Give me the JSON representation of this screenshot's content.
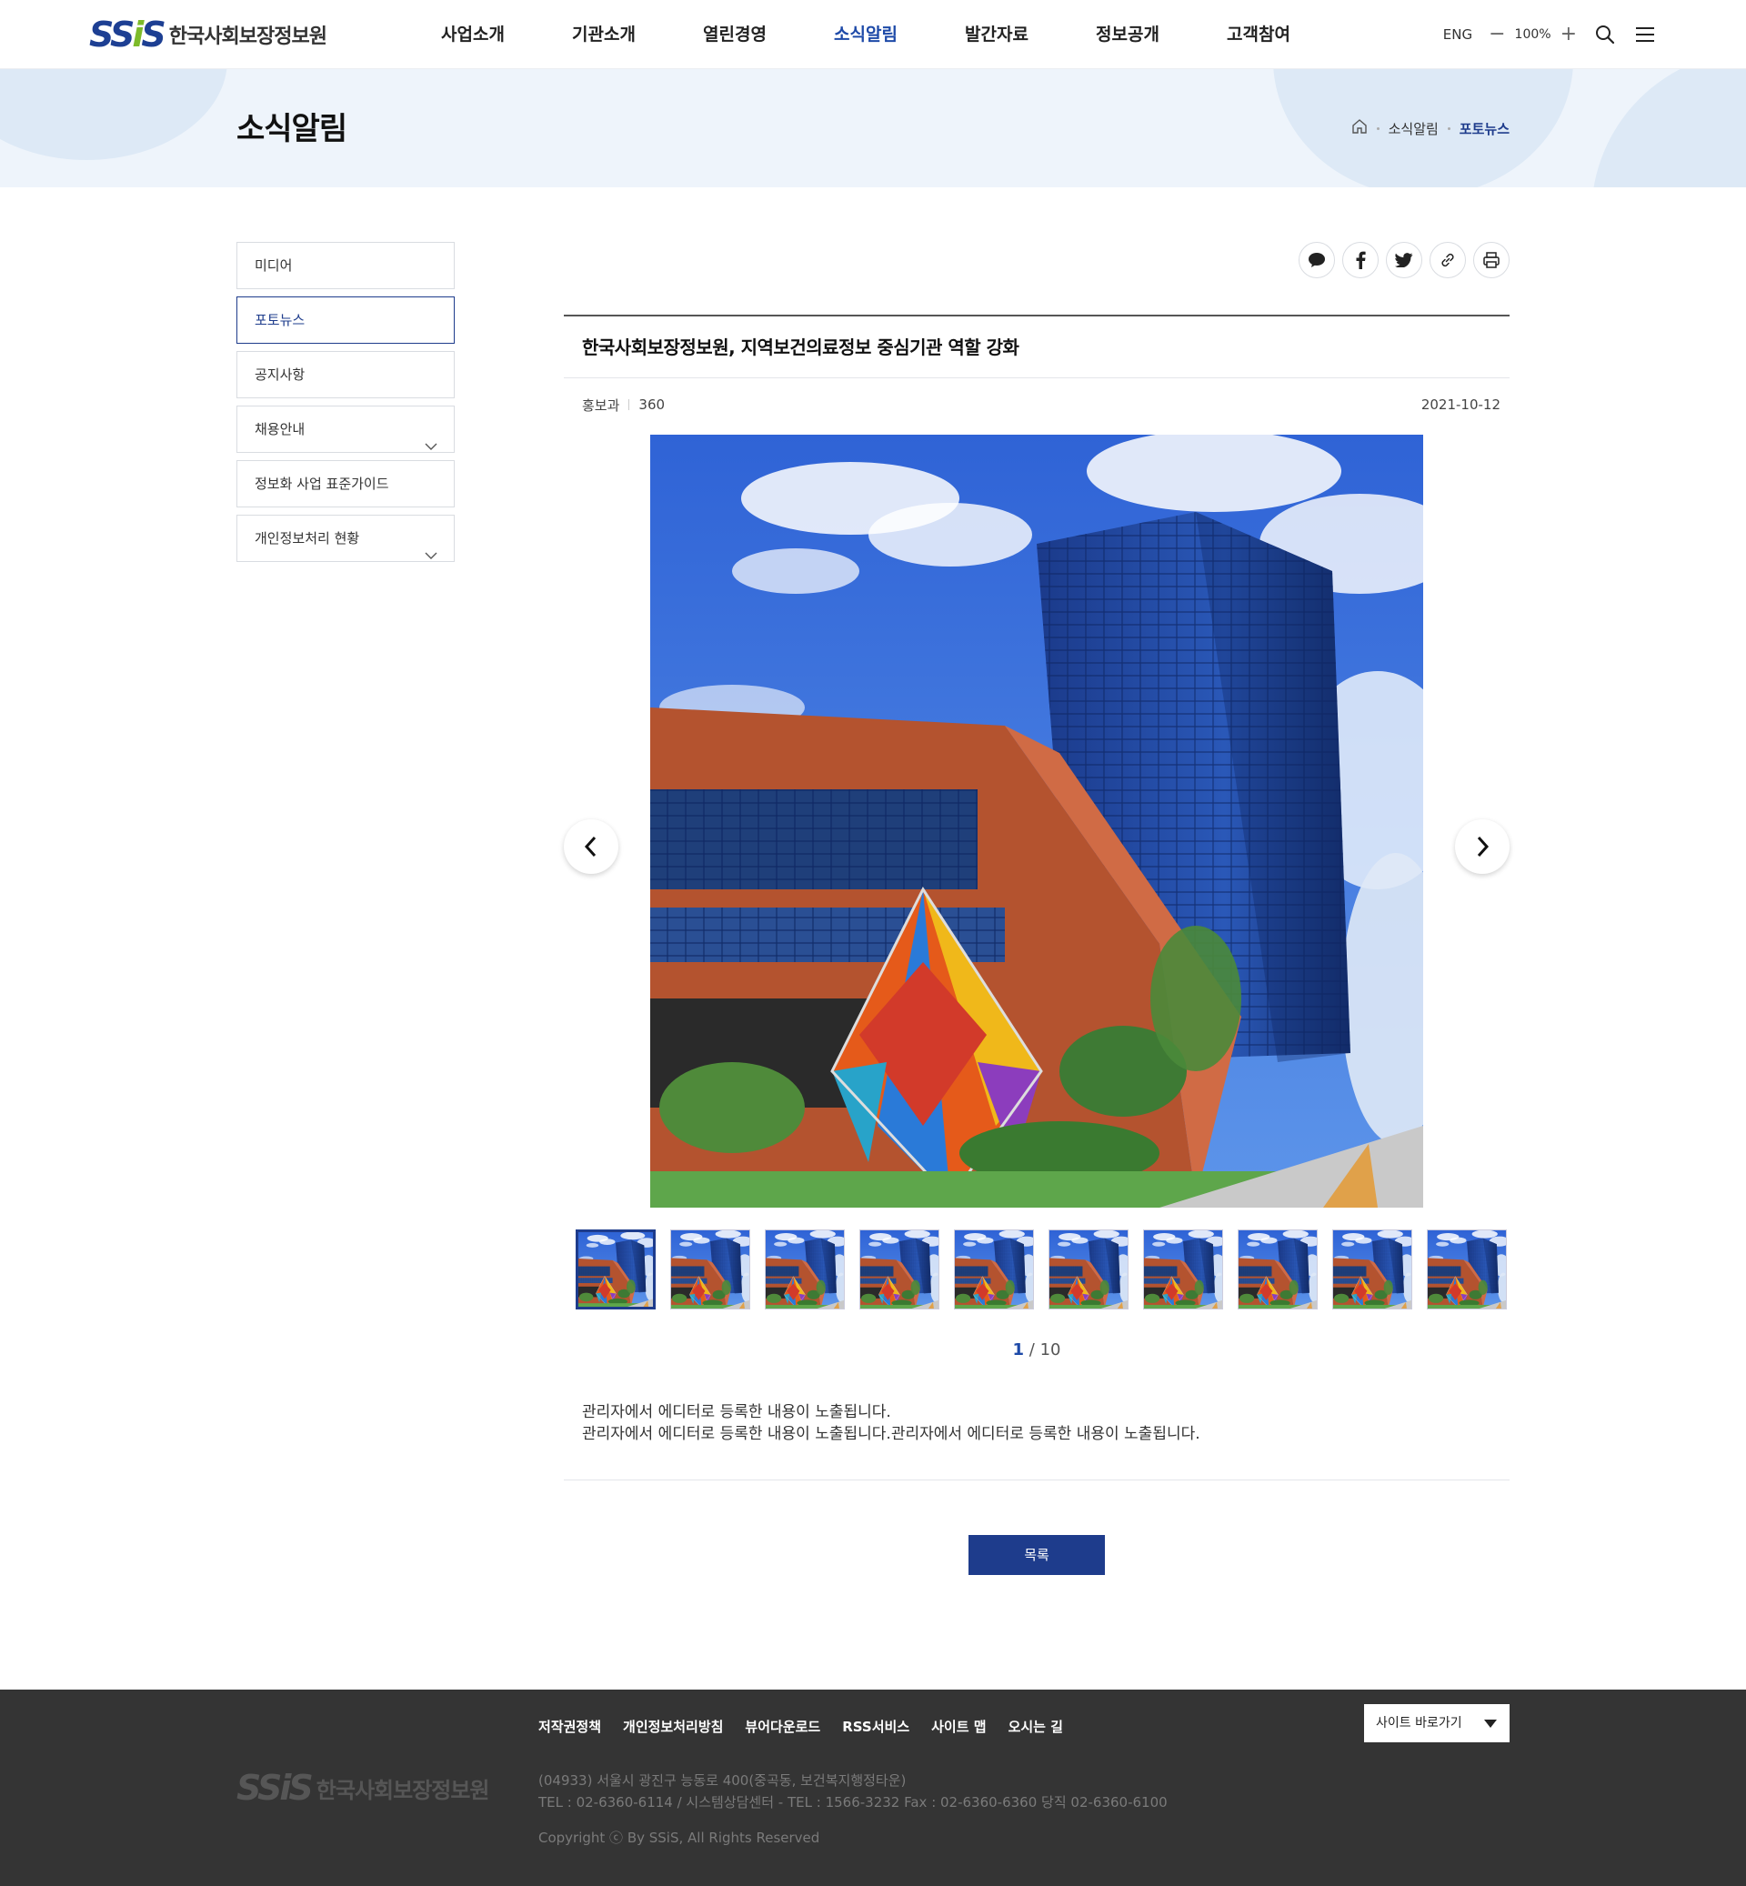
{
  "header": {
    "logo_mark": "SSiS",
    "logo_text": "한국사회보장정보원",
    "menu": [
      "사업소개",
      "기관소개",
      "열린경영",
      "소식알림",
      "발간자료",
      "정보공개",
      "고객참여"
    ],
    "lang": "ENG",
    "zoom_minus": "−",
    "zoom_value": "100%",
    "zoom_plus": "+"
  },
  "subvisual": {
    "title": "소식알림",
    "breadcrumb": [
      "소식알림",
      "포토뉴스"
    ]
  },
  "lnb": {
    "items": [
      {
        "label": "미디어"
      },
      {
        "label": "포토뉴스"
      },
      {
        "label": "공지사항"
      },
      {
        "label": "채용안내"
      },
      {
        "label": "정보화 사업 표준가이드"
      },
      {
        "label": "개인정보처리 현황"
      }
    ]
  },
  "article": {
    "title": "한국사회보장정보원, 지역보건의료정보 중심기관 역할 강화",
    "department": "홍보과",
    "views": "360",
    "date": "2021-10-12",
    "counter_current": "1",
    "counter_sep": " / ",
    "counter_total": "10",
    "body_line1": "관리자에서 에디터로 등록한 내용이 노출됩니다.",
    "body_line2": "관리자에서 에디터로 등록한 내용이 노출됩니다.관리자에서 에디터로 등록한 내용이 노출됩니다.",
    "list_button": "목록"
  },
  "footer": {
    "links": [
      "저작권정책",
      "개인정보처리방침",
      "뷰어다운로드",
      "RSS서비스",
      "사이트 맵",
      "오시는 길"
    ],
    "family_site": "사이트 바로가기",
    "logo_mark": "SSiS",
    "logo_text": "한국사회보장정보원",
    "address": "(04933) 서울시 광진구 능동로 400(중곡동, 보건복지행정타운)",
    "tel": "TEL :  02-6360-6114 / 시스템상담센터 - TEL : 1566-3232  Fax :  02-6360-6360  당직 02-6360-6100",
    "copyright": "Copyright ⓒ By SSiS, All Rights Reserved"
  },
  "colors": {
    "primary": "#1e3c8c",
    "accent": "#1e4aa8",
    "logo_green": "#7dbb2a",
    "footer_bg": "#343434",
    "subvisual_bg": "#eef4fb"
  },
  "icons": {
    "header": [
      "search-icon",
      "hamburger-menu-icon"
    ],
    "breadcrumb": [
      "home-icon"
    ],
    "share": [
      "kakaotalk-icon",
      "facebook-icon",
      "twitter-icon",
      "link-icon",
      "print-icon"
    ],
    "gallery": [
      "chevron-left-icon",
      "chevron-right-icon"
    ]
  }
}
